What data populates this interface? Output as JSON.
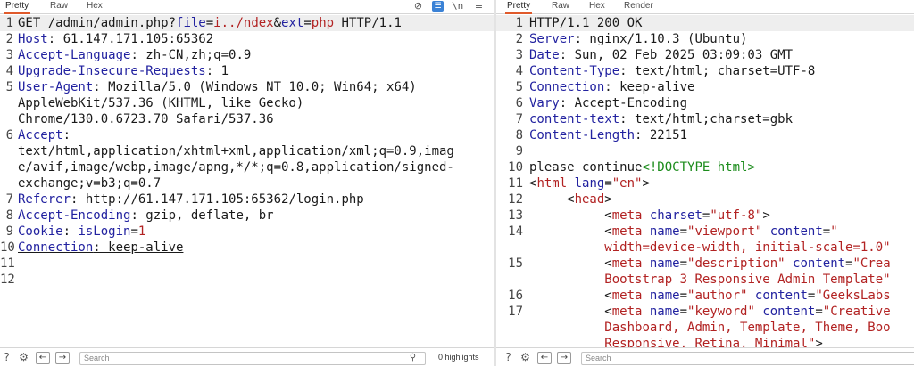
{
  "request_pane": {
    "tabs": [
      "Pretty",
      "Raw",
      "Hex"
    ],
    "active_tab": "Pretty",
    "toolbar": {
      "slash_n_label": "\\n"
    },
    "lines": [
      {
        "n": "1",
        "hl": true,
        "segs": [
          [
            "GET /admin/admin.php?",
            ""
          ],
          [
            "file",
            "k"
          ],
          [
            "=",
            ""
          ],
          [
            "i../ndex",
            "p"
          ],
          [
            "&",
            ""
          ],
          [
            "ext",
            "k"
          ],
          [
            "=",
            ""
          ],
          [
            "php",
            "p"
          ],
          [
            " HTTP/1.1",
            ""
          ]
        ]
      },
      {
        "n": "2",
        "segs": [
          [
            "Host",
            "k"
          ],
          [
            ": 61.147.171.105:65362",
            ""
          ]
        ]
      },
      {
        "n": "3",
        "segs": [
          [
            "Accept-Language",
            "k"
          ],
          [
            ": zh-CN,zh;q=0.9",
            ""
          ]
        ]
      },
      {
        "n": "4",
        "segs": [
          [
            "Upgrade-Insecure-Requests",
            "k"
          ],
          [
            ": 1",
            ""
          ]
        ]
      },
      {
        "n": "5",
        "segs": [
          [
            "User-Agent",
            "k"
          ],
          [
            ": Mozilla/5.0 (Windows NT 10.0; Win64; x64)",
            ""
          ]
        ]
      },
      {
        "n": "",
        "segs": [
          [
            "AppleWebKit/537.36 (KHTML, like Gecko)",
            ""
          ]
        ]
      },
      {
        "n": "",
        "segs": [
          [
            "Chrome/130.0.6723.70 Safari/537.36",
            ""
          ]
        ]
      },
      {
        "n": "6",
        "segs": [
          [
            "Accept",
            "k"
          ],
          [
            ":",
            ""
          ]
        ]
      },
      {
        "n": "",
        "segs": [
          [
            "text/html,application/xhtml+xml,application/xml;q=0.9,imag",
            ""
          ]
        ]
      },
      {
        "n": "",
        "segs": [
          [
            "e/avif,image/webp,image/apng,*/*;q=0.8,application/signed-",
            ""
          ]
        ]
      },
      {
        "n": "",
        "segs": [
          [
            "exchange;v=b3;q=0.7",
            ""
          ]
        ]
      },
      {
        "n": "7",
        "segs": [
          [
            "Referer",
            "k"
          ],
          [
            ": http://61.147.171.105:65362/login.php",
            ""
          ]
        ]
      },
      {
        "n": "8",
        "segs": [
          [
            "Accept-Encoding",
            "k"
          ],
          [
            ": gzip, deflate, br",
            ""
          ]
        ]
      },
      {
        "n": "9",
        "segs": [
          [
            "Cookie",
            "k"
          ],
          [
            ": ",
            ""
          ],
          [
            "isLogin",
            "k"
          ],
          [
            "=",
            ""
          ],
          [
            "1",
            "p"
          ]
        ]
      },
      {
        "n": "10",
        "segs": [
          [
            "Connection",
            "k u"
          ],
          [
            ": keep-alive",
            "u"
          ]
        ]
      },
      {
        "n": "11",
        "segs": []
      },
      {
        "n": "12",
        "segs": []
      }
    ],
    "search": {
      "placeholder": "Search",
      "highlights": "0 highlights"
    }
  },
  "response_pane": {
    "tabs": [
      "Pretty",
      "Raw",
      "Hex",
      "Render"
    ],
    "active_tab": "Pretty",
    "lines": [
      {
        "n": "1",
        "hl": true,
        "segs": [
          [
            "HTTP/1.1 200 OK",
            ""
          ]
        ]
      },
      {
        "n": "2",
        "segs": [
          [
            "Server",
            "k"
          ],
          [
            ": nginx/1.10.3 (Ubuntu)",
            ""
          ]
        ]
      },
      {
        "n": "3",
        "segs": [
          [
            "Date",
            "k"
          ],
          [
            ": Sun, 02 Feb 2025 03:09:03 GMT",
            ""
          ]
        ]
      },
      {
        "n": "4",
        "segs": [
          [
            "Content-Type",
            "k"
          ],
          [
            ": text/html; charset=UTF-8",
            ""
          ]
        ]
      },
      {
        "n": "5",
        "segs": [
          [
            "Connection",
            "k"
          ],
          [
            ": keep-alive",
            ""
          ]
        ]
      },
      {
        "n": "6",
        "segs": [
          [
            "Vary",
            "k"
          ],
          [
            ": Accept-Encoding",
            ""
          ]
        ]
      },
      {
        "n": "7",
        "segs": [
          [
            "content-text",
            "k"
          ],
          [
            ": text/html;charset=gbk",
            ""
          ]
        ]
      },
      {
        "n": "8",
        "segs": [
          [
            "Content-Length",
            "k"
          ],
          [
            ": 22151",
            ""
          ]
        ]
      },
      {
        "n": "9",
        "segs": []
      },
      {
        "n": "10",
        "segs": [
          [
            "please continue",
            ""
          ],
          [
            "<!DOCTYPE html>",
            "g"
          ]
        ]
      },
      {
        "n": "11",
        "segs": [
          [
            "<",
            ""
          ],
          [
            "html",
            "t"
          ],
          [
            " ",
            ""
          ],
          [
            "lang",
            "a"
          ],
          [
            "=",
            ""
          ],
          [
            "\"en\"",
            "v"
          ],
          [
            ">",
            ""
          ]
        ]
      },
      {
        "n": "12",
        "segs": [
          [
            "     <",
            ""
          ],
          [
            "head",
            "t"
          ],
          [
            ">",
            ""
          ]
        ]
      },
      {
        "n": "13",
        "segs": [
          [
            "          <",
            ""
          ],
          [
            "meta",
            "t"
          ],
          [
            " ",
            ""
          ],
          [
            "charset",
            "a"
          ],
          [
            "=",
            ""
          ],
          [
            "\"utf-8\"",
            "v"
          ],
          [
            ">",
            ""
          ]
        ]
      },
      {
        "n": "14",
        "segs": [
          [
            "          <",
            ""
          ],
          [
            "meta",
            "t"
          ],
          [
            " ",
            ""
          ],
          [
            "name",
            "a"
          ],
          [
            "=",
            ""
          ],
          [
            "\"viewport\"",
            "v"
          ],
          [
            " ",
            ""
          ],
          [
            "content",
            "a"
          ],
          [
            "=",
            ""
          ],
          [
            "\"",
            "v"
          ]
        ]
      },
      {
        "n": "",
        "segs": [
          [
            "          ",
            ""
          ],
          [
            "width=device-width, initial-scale=1.0\"",
            "v"
          ]
        ]
      },
      {
        "n": "15",
        "segs": [
          [
            "          <",
            ""
          ],
          [
            "meta",
            "t"
          ],
          [
            " ",
            ""
          ],
          [
            "name",
            "a"
          ],
          [
            "=",
            ""
          ],
          [
            "\"description\"",
            "v"
          ],
          [
            " ",
            ""
          ],
          [
            "content",
            "a"
          ],
          [
            "=",
            ""
          ],
          [
            "\"Crea",
            "v"
          ]
        ]
      },
      {
        "n": "",
        "segs": [
          [
            "          ",
            ""
          ],
          [
            "Bootstrap 3 Responsive Admin Template\"",
            "v"
          ]
        ]
      },
      {
        "n": "16",
        "segs": [
          [
            "          <",
            ""
          ],
          [
            "meta",
            "t"
          ],
          [
            " ",
            ""
          ],
          [
            "name",
            "a"
          ],
          [
            "=",
            ""
          ],
          [
            "\"author\"",
            "v"
          ],
          [
            " ",
            ""
          ],
          [
            "content",
            "a"
          ],
          [
            "=",
            ""
          ],
          [
            "\"GeeksLabs",
            "v"
          ]
        ]
      },
      {
        "n": "17",
        "segs": [
          [
            "          <",
            ""
          ],
          [
            "meta",
            "t"
          ],
          [
            " ",
            ""
          ],
          [
            "name",
            "a"
          ],
          [
            "=",
            ""
          ],
          [
            "\"keyword\"",
            "v"
          ],
          [
            " ",
            ""
          ],
          [
            "content",
            "a"
          ],
          [
            "=",
            ""
          ],
          [
            "\"Creative",
            "v"
          ]
        ]
      },
      {
        "n": "",
        "segs": [
          [
            "          ",
            ""
          ],
          [
            "Dashboard, Admin, Template, Theme, Boo",
            "v"
          ]
        ]
      },
      {
        "n": "",
        "segs": [
          [
            "          ",
            ""
          ],
          [
            "Responsive, Retina, Minimal\"",
            "v"
          ],
          [
            ">",
            ""
          ]
        ]
      }
    ],
    "search": {
      "placeholder": "Search"
    }
  },
  "colors": {
    "accent_tab": "#e05a2b",
    "keyword": "#2222a0",
    "value": "#b22222",
    "doctype": "#1c8c1c"
  }
}
